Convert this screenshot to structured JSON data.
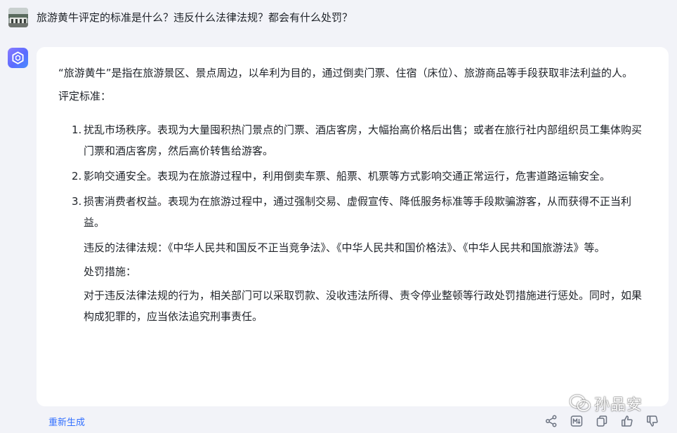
{
  "user": {
    "question": "旅游黄牛评定的标准是什么？违反什么法律法规？都会有什么处罚？"
  },
  "answer": {
    "intro": "“旅游黄牛”是指在旅游景区、景点周边，以牟利为目的，通过倒卖门票、住宿（床位）、旅游商品等手段获取非法利益的人。",
    "criteria_heading": "评定标准：",
    "criteria": [
      {
        "num": "1.",
        "text": "扰乱市场秩序。表现为大量囤积热门景点的门票、酒店客房，大幅抬高价格后出售；或者在旅行社内部组织员工集体购买门票和酒店客房，然后高价转售给游客。"
      },
      {
        "num": "2.",
        "text": "影响交通安全。表现为在旅游过程中，利用倒卖车票、船票、机票等方式影响交通正常运行，危害道路运输安全。"
      },
      {
        "num": "3.",
        "text": "损害消费者权益。表现为在旅游过程中，通过强制交易、虚假宣传、降低服务标准等手段欺骗游客，从而获得不正当利益。"
      }
    ],
    "laws": "违反的法律法规：《中华人民共和国反不正当竞争法》、《中华人民共和国价格法》、《中华人民共和国旅游法》等。",
    "penalty_heading": "处罚措施：",
    "penalty": "对于违反法律法规的行为，相关部门可以采取罚款、没收违法所得、责令停业整顿等行政处罚措施进行惩处。同时，如果构成犯罪的，应当依法追究刑事责任。"
  },
  "footer": {
    "regenerate_label": "重新生成"
  },
  "watermark": {
    "text": "孙品安"
  },
  "icons": {
    "share": "share-icon",
    "markdown": "markdown-icon",
    "copy": "copy-icon",
    "like": "thumbs-up-icon",
    "dislike": "thumbs-down-icon"
  },
  "colors": {
    "background": "#f2f3f8",
    "card": "#ffffff",
    "text": "#1f2329",
    "link": "#3370ff",
    "icon": "#6b7280"
  }
}
